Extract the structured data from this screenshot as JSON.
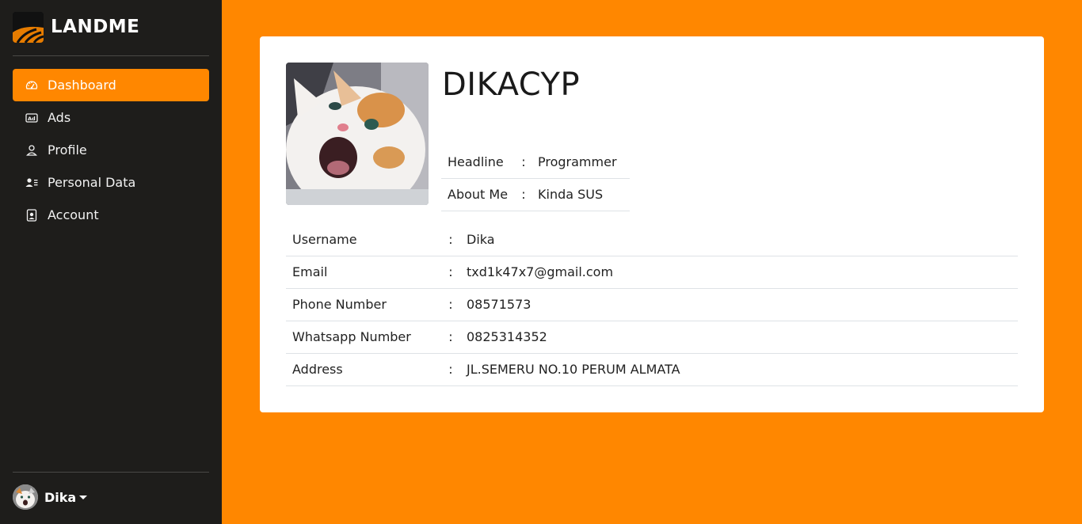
{
  "brand": {
    "name": "LANDME",
    "accent": "#ff8700"
  },
  "nav": [
    {
      "label": "Dashboard",
      "icon": "speedometer-icon",
      "active": true
    },
    {
      "label": "Ads",
      "icon": "ad-icon",
      "active": false
    },
    {
      "label": "Profile",
      "icon": "person-icon",
      "active": false
    },
    {
      "label": "Personal Data",
      "icon": "person-lines-icon",
      "active": false
    },
    {
      "label": "Account",
      "icon": "person-badge-icon",
      "active": false
    }
  ],
  "user": {
    "name": "Dika"
  },
  "profile": {
    "display_name": "DIKACYP",
    "headline_label": "Headline",
    "headline": "Programmer",
    "about_label": "About Me",
    "about": "Kinda SUS",
    "separator": ":"
  },
  "details": [
    {
      "label": "Username",
      "value": "Dika"
    },
    {
      "label": "Email",
      "value": "txd1k47x7@gmail.com"
    },
    {
      "label": "Phone Number",
      "value": "08571573"
    },
    {
      "label": "Whatsapp Number",
      "value": "0825314352"
    },
    {
      "label": "Address",
      "value": "JL.SEMERU NO.10 PERUM ALMATA"
    }
  ]
}
